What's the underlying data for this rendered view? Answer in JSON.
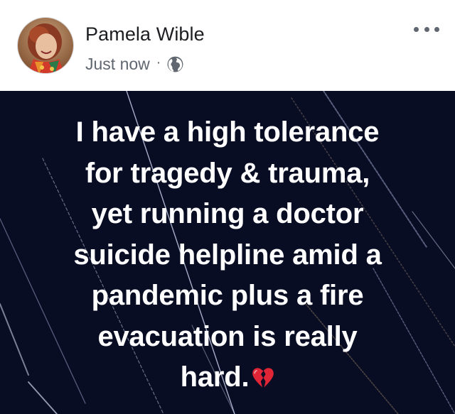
{
  "post": {
    "author": {
      "name": "Pamela Wible",
      "avatar_icon": "profile-photo"
    },
    "timestamp": "Just now",
    "separator": "·",
    "privacy_icon": "globe-icon",
    "more_icon": "ellipsis-icon",
    "status": {
      "text": "I have a high tolerance\nfor tragedy & trauma,\nyet running a doctor\nsuicide helpline amid a\npandemic plus a fire\nevacuation is really\nhard.",
      "emoji_icon": "broken-heart-icon",
      "background_color": "#080d24",
      "text_color": "#ffffff"
    }
  },
  "colors": {
    "name": "#1c1e21",
    "meta": "#606770",
    "heart": "#e02536"
  }
}
